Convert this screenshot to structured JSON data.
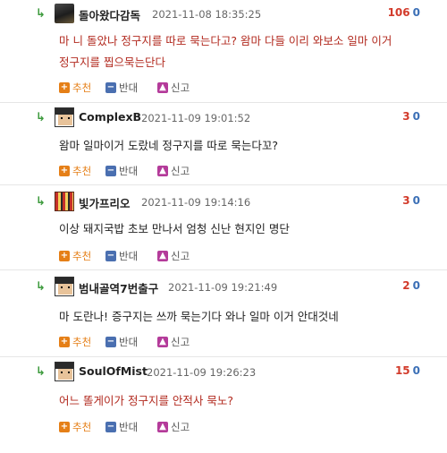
{
  "actions": {
    "recommend": "추천",
    "oppose": "반대",
    "report": "신고"
  },
  "comments": [
    {
      "nickname": "돌아왔다감독",
      "date": "2021-11-08 18:35:25",
      "up": "106",
      "down": "0",
      "lines": [
        "마 니 돌았나 정구지를 따로 묵는다고? 왐마 다들 이리 와보소 일마 이거",
        "정구지를 찝으묵는단다"
      ]
    },
    {
      "nickname": "ComplexB",
      "date": "2021-11-09 19:01:52",
      "up": "3",
      "down": "0",
      "lines": [
        "왐마 일마이거 도랐네 정구지를 따로 묵는다꼬?"
      ]
    },
    {
      "nickname": "빛가프리오",
      "date": "2021-11-09 19:14:16",
      "up": "3",
      "down": "0",
      "lines": [
        "이상 돼지국밥 초보 만나서 엄청 신난 현지인 명단"
      ]
    },
    {
      "nickname": "범내골역7번출구",
      "date": "2021-11-09 19:21:49",
      "up": "2",
      "down": "0",
      "lines": [
        "마 도란나! 증구지는 쓰까 묵는기다 와나 일마 이거 안대것네"
      ]
    },
    {
      "nickname": "SoulOfMist",
      "date": "2021-11-09 19:26:23",
      "up": "15",
      "down": "0",
      "lines": [
        "어느 똘게이가 정구지를 안적사 묵노?"
      ]
    }
  ],
  "colors": {
    "reply_arrow": "#3c9a3c",
    "up_vote": "#d23a2a",
    "down_vote": "#3b6fb6",
    "red_text": "#b22a1f"
  },
  "icons": {
    "reply": "reply-arrow-icon",
    "recommend": "plus-icon",
    "oppose": "minus-icon",
    "report": "siren-icon"
  }
}
